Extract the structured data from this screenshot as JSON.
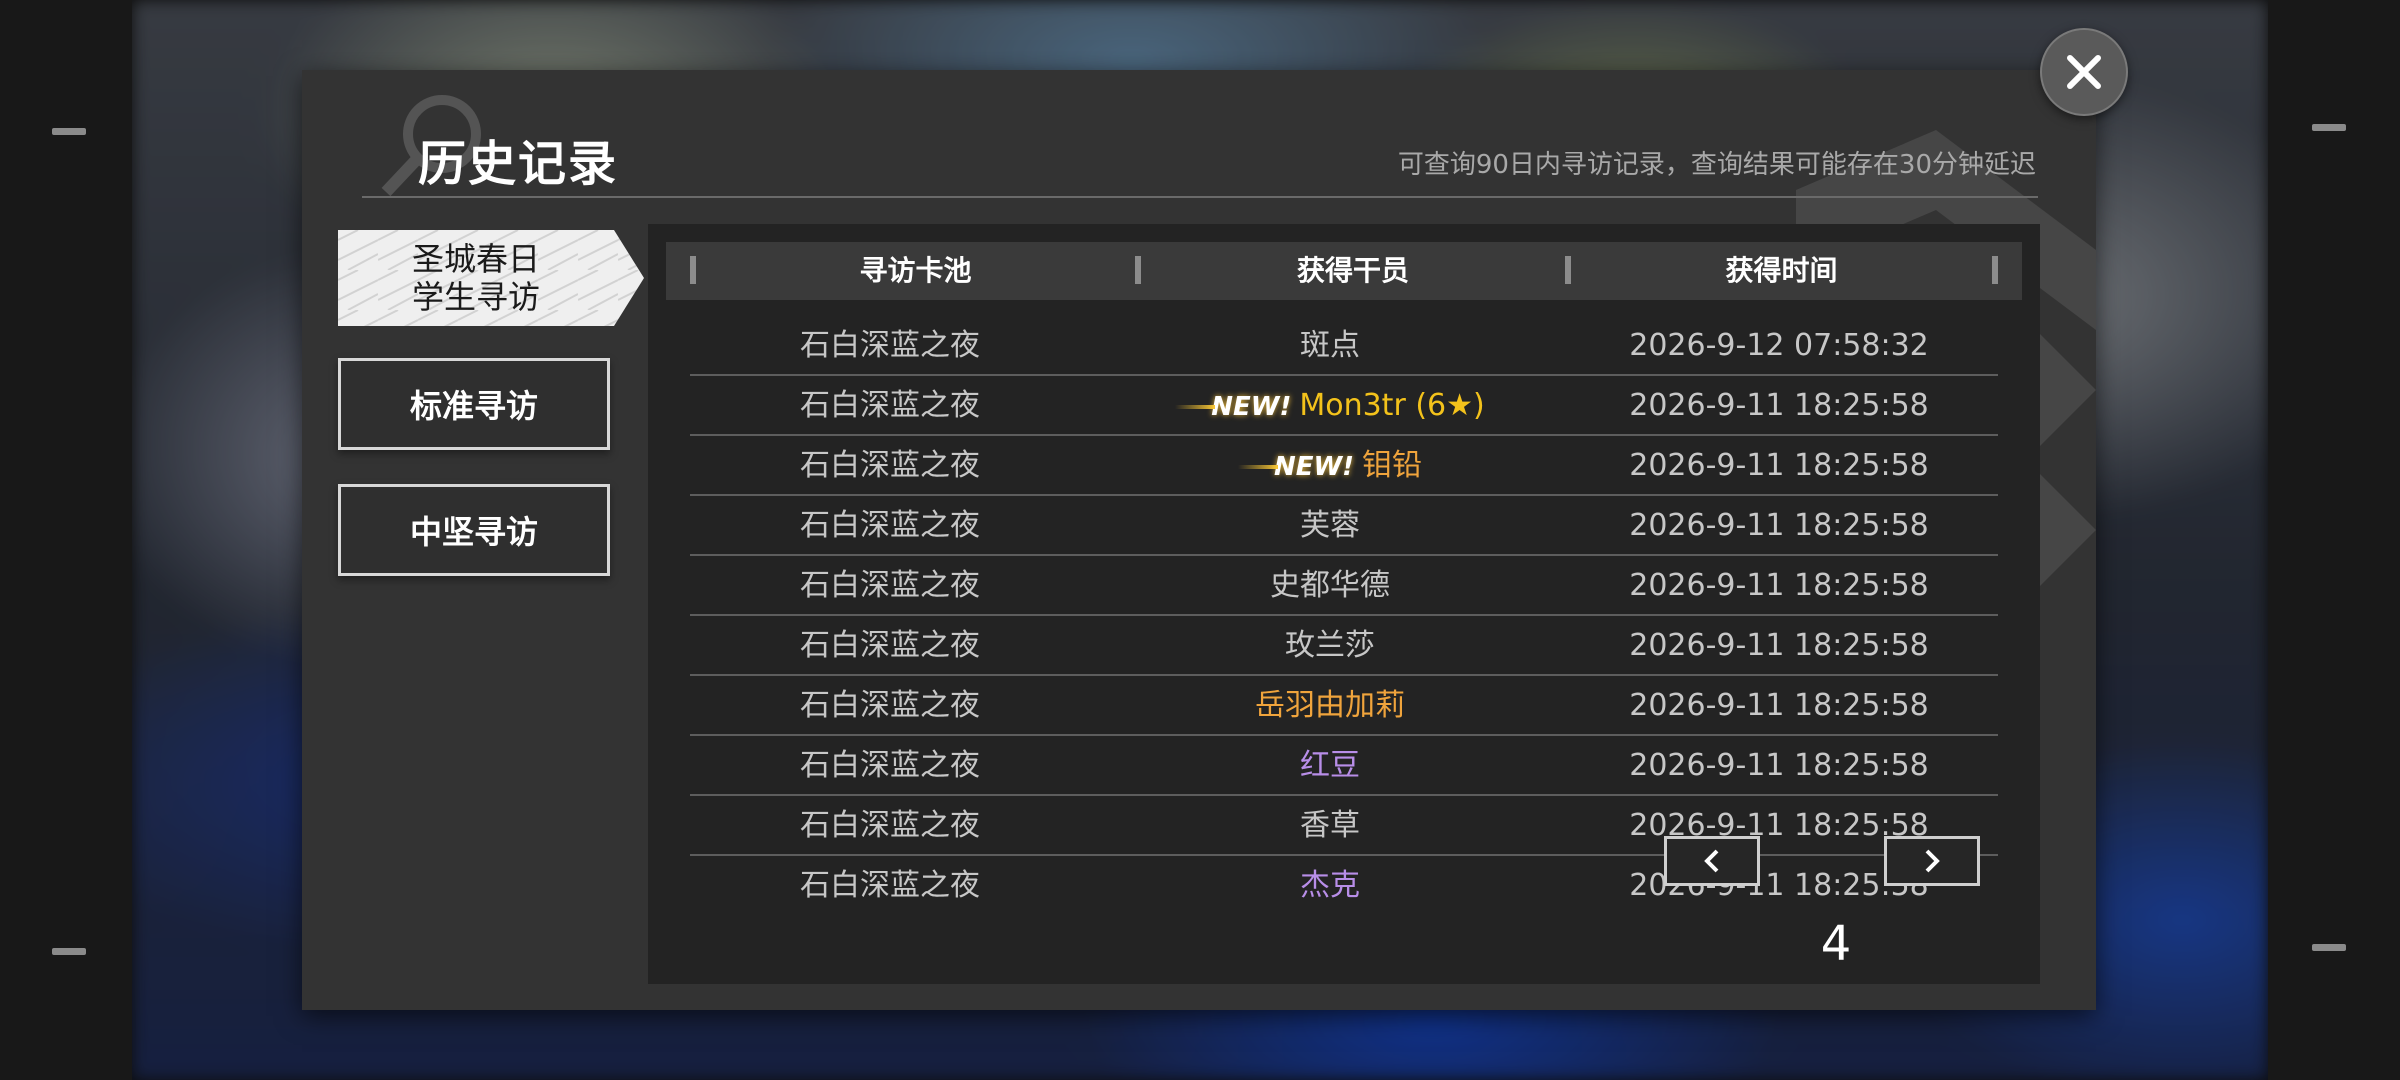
{
  "header": {
    "title": "历史记录",
    "subtitle": "可查询90日内寻访记录，查询结果可能存在30分钟延迟"
  },
  "tabs": [
    {
      "label_line1": "圣城春日",
      "label_line2": "学生寻访",
      "active": true
    },
    {
      "label": "标准寻访",
      "active": false
    },
    {
      "label": "中坚寻访",
      "active": false
    }
  ],
  "table": {
    "columns": [
      "寻访卡池",
      "获得干员",
      "获得时间"
    ],
    "new_badge_text": "NEW!",
    "rows": [
      {
        "pool": "石白深蓝之夜",
        "operator": "斑点",
        "time": "2026-9-12 07:58:32",
        "color": "#c7c7c7",
        "is_new": false
      },
      {
        "pool": "石白深蓝之夜",
        "operator": "Mon3tr (6★)",
        "time": "2026-9-11 18:25:58",
        "color": "#f3c21b",
        "is_new": true
      },
      {
        "pool": "石白深蓝之夜",
        "operator": "钼铅",
        "time": "2026-9-11 18:25:58",
        "color": "#f0a43c",
        "is_new": true
      },
      {
        "pool": "石白深蓝之夜",
        "operator": "芙蓉",
        "time": "2026-9-11 18:25:58",
        "color": "#c7c7c7",
        "is_new": false
      },
      {
        "pool": "石白深蓝之夜",
        "operator": "史都华德",
        "time": "2026-9-11 18:25:58",
        "color": "#c7c7c7",
        "is_new": false
      },
      {
        "pool": "石白深蓝之夜",
        "operator": "玫兰莎",
        "time": "2026-9-11 18:25:58",
        "color": "#c7c7c7",
        "is_new": false
      },
      {
        "pool": "石白深蓝之夜",
        "operator": "岳羽由加莉",
        "time": "2026-9-11 18:25:58",
        "color": "#f0a43c",
        "is_new": false
      },
      {
        "pool": "石白深蓝之夜",
        "operator": "红豆",
        "time": "2026-9-11 18:25:58",
        "color": "#b88ee8",
        "is_new": false
      },
      {
        "pool": "石白深蓝之夜",
        "operator": "香草",
        "time": "2026-9-11 18:25:58",
        "color": "#c7c7c7",
        "is_new": false
      },
      {
        "pool": "石白深蓝之夜",
        "operator": "杰克",
        "time": "2026-9-11 18:25:58",
        "color": "#b88ee8",
        "is_new": false
      }
    ]
  },
  "pagination": {
    "current_page": "4",
    "prev_icon": "chevron-left-icon",
    "next_icon": "chevron-right-icon"
  },
  "close_icon": "close-icon",
  "colors": {
    "dialog_bg": "#333333",
    "panel_bg": "#232323",
    "rarity_6": "#f3c21b",
    "rarity_5": "#f0a43c",
    "rarity_4": "#b88ee8",
    "rarity_default": "#c7c7c7"
  }
}
